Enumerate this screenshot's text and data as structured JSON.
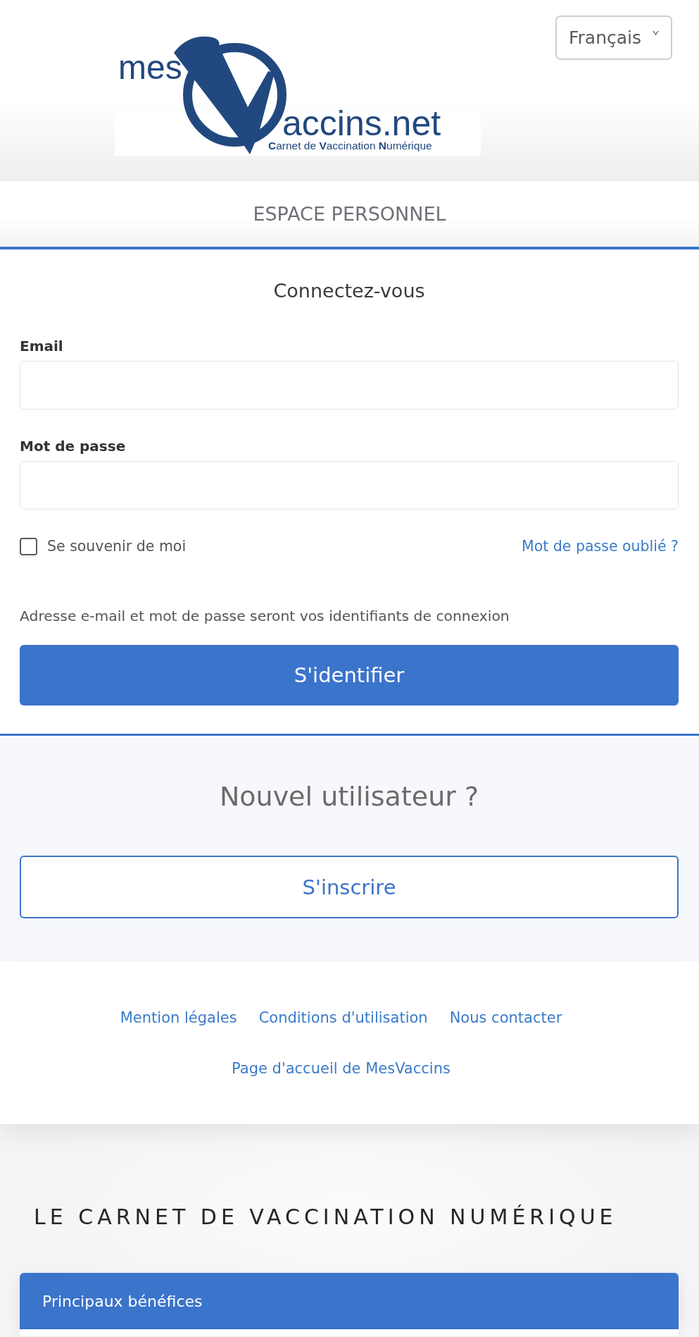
{
  "header": {
    "logo": {
      "prefix": "mes",
      "suffix": "accins.net",
      "tagline": "**C**arnet de **V**accination **N**umérique"
    },
    "language": {
      "value": "Français"
    }
  },
  "login": {
    "heading": "ESPACE PERSONNEL",
    "title": "Connectez-vous",
    "fields": [
      {
        "label": "Email"
      },
      {
        "label": "Mot de passe"
      }
    ],
    "remember": {
      "label": "Se souvenir de moi",
      "checked": false
    },
    "forgot_link": "Mot de passe oublié ?",
    "hint": "Adresse e-mail et mot de passe seront vos identifiants de connexion",
    "submit": "S'identifier"
  },
  "signup": {
    "title": "Nouvel utilisateur ?",
    "button": "S'inscrire"
  },
  "footer": {
    "links": [
      "Mention légales",
      "Conditions d'utilisation",
      "Nous contacter"
    ],
    "home_link": "Page d'accueil de MesVaccins"
  },
  "about": {
    "title": "LE CARNET DE VACCINATION NUMÉRIQUE",
    "panels": [
      {
        "title": "Principaux bénéfices"
      }
    ]
  }
}
